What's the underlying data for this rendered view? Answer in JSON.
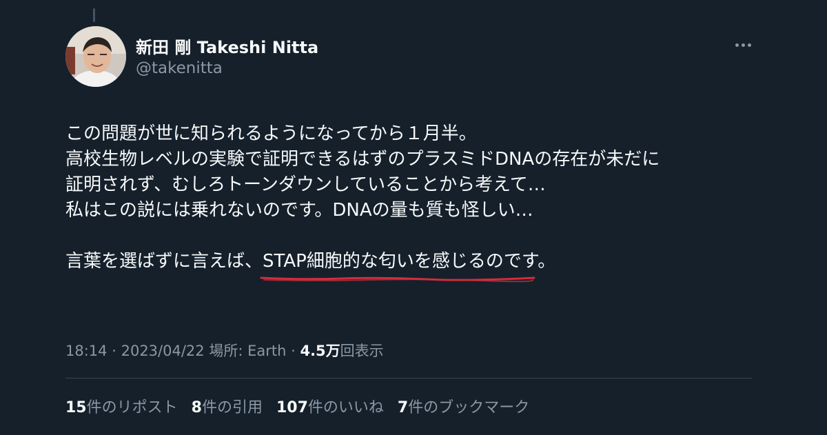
{
  "tweet": {
    "author_name": "新田 剛 Takeshi Nitta",
    "author_handle": "@takenitta",
    "text_lines": [
      "この問題が世に知られるようになってから１月半。",
      "高校生物レベルの実験で証明できるはずのプラスミドDNAの存在が未だに",
      "証明されず、むしろトーンダウンしていることから考えて…",
      "私はこの説には乗れないのです。DNAの量も質も怪しい…"
    ],
    "last_line_prefix": "言葉を選ばずに言えば、",
    "last_line_highlight": "STAP細胞的な匂いを感じる",
    "last_line_suffix": "のです。",
    "time": "18:14",
    "separator": "·",
    "date": "2023/04/22",
    "location": "場所: Earth",
    "views_count": "4.5万",
    "views_label": "回表示"
  },
  "stats": [
    {
      "count": "15",
      "label": "件のリポスト"
    },
    {
      "count": "8",
      "label": "件の引用"
    },
    {
      "count": "107",
      "label": "件のいいね"
    },
    {
      "count": "7",
      "label": "件のブックマーク"
    }
  ],
  "colors": {
    "background": "#15202b",
    "text": "#f7f9f9",
    "secondary_text": "#8b98a5",
    "divider": "#38444d",
    "annotation_underline": "#d12d3c"
  },
  "icons": {
    "more": "more-horizontal-icon"
  }
}
